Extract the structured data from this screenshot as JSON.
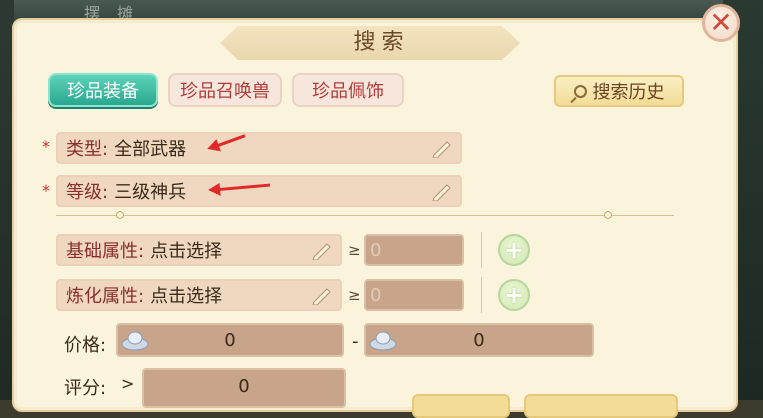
{
  "background": {
    "top_text": "摆 摊"
  },
  "dialog": {
    "title": "搜索"
  },
  "tabs": [
    {
      "label": "珍品装备",
      "active": true
    },
    {
      "label": "珍品召唤兽",
      "active": false
    },
    {
      "label": "珍品佩饰",
      "active": false
    }
  ],
  "history_button": {
    "label": "搜索历史",
    "icon": "magnifier-icon"
  },
  "required_marker": "*",
  "type_field": {
    "label": "类型:",
    "value": "全部武器"
  },
  "level_field": {
    "label": "等级:",
    "value": "三级神兵"
  },
  "base_attr": {
    "label": "基础属性:",
    "value": "点击选择",
    "ge": "≥",
    "min": "0"
  },
  "refine_attr": {
    "label": "炼化属性:",
    "value": "点击选择",
    "ge": "≥",
    "min": "0"
  },
  "price": {
    "label": "价格:",
    "min": "0",
    "separator": "-",
    "max": "0"
  },
  "score": {
    "label": "评分:",
    "ge": ">",
    "min": "0"
  },
  "colors": {
    "accent": "#29a88f",
    "arrow": "#e02a2a",
    "close": "#d04a3c"
  }
}
